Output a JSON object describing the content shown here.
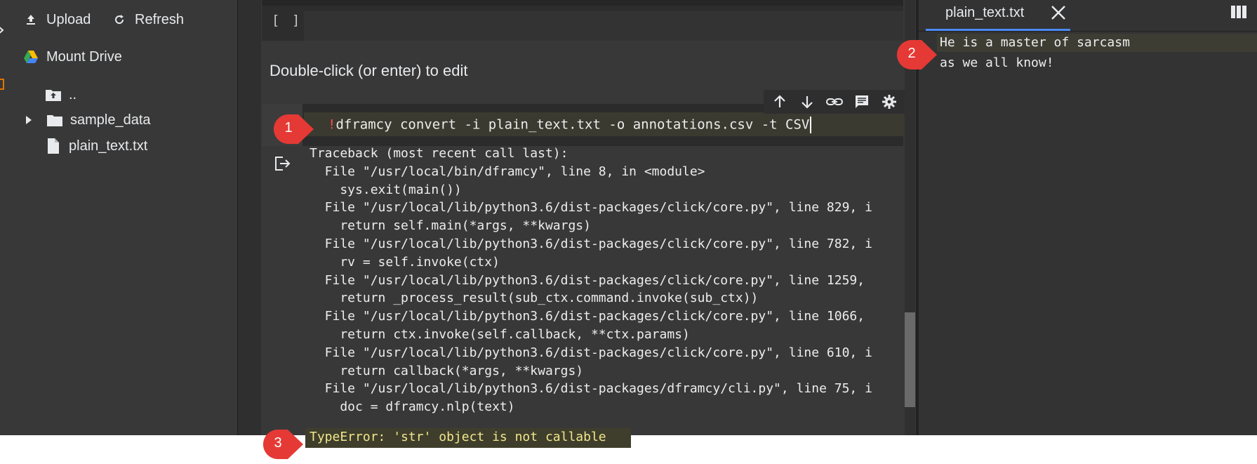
{
  "files_panel": {
    "upload_label": "Upload",
    "refresh_label": "Refresh",
    "mount_drive_label": "Mount Drive",
    "items": [
      {
        "label": ".."
      },
      {
        "label": "sample_data"
      },
      {
        "label": "plain_text.txt"
      }
    ]
  },
  "notebook": {
    "empty_cell_brackets": "[ ]",
    "markdown_hint": "Double-click (or enter) to edit",
    "command": {
      "bang": "!",
      "text": "dframcy convert -i plain_text.txt -o annotations.csv -t CSV"
    },
    "traceback": [
      "Traceback (most recent call last):",
      "  File \"/usr/local/bin/dframcy\", line 8, in <module>",
      "    sys.exit(main())",
      "  File \"/usr/local/lib/python3.6/dist-packages/click/core.py\", line 829, i",
      "    return self.main(*args, **kwargs)",
      "  File \"/usr/local/lib/python3.6/dist-packages/click/core.py\", line 782, i",
      "    rv = self.invoke(ctx)",
      "  File \"/usr/local/lib/python3.6/dist-packages/click/core.py\", line 1259,",
      "    return _process_result(sub_ctx.command.invoke(sub_ctx))",
      "  File \"/usr/local/lib/python3.6/dist-packages/click/core.py\", line 1066,",
      "    return ctx.invoke(self.callback, **ctx.params)",
      "  File \"/usr/local/lib/python3.6/dist-packages/click/core.py\", line 610, i",
      "    return callback(*args, **kwargs)",
      "  File \"/usr/local/lib/python3.6/dist-packages/dframcy/cli.py\", line 75, i",
      "    doc = dframcy.nlp(text)"
    ],
    "error_line": "TypeError: 'str' object is not callable"
  },
  "viewer": {
    "tab_title": "plain_text.txt",
    "lines": [
      "He is a master of sarcasm",
      "as we all know!"
    ]
  },
  "callouts": {
    "one": "1",
    "two": "2",
    "three": "3"
  },
  "colors": {
    "callout_red": "#e53935",
    "accent_blue": "#4a8af4",
    "bang_red": "#ff4b4b",
    "error_yellow": "#f0e68c"
  }
}
